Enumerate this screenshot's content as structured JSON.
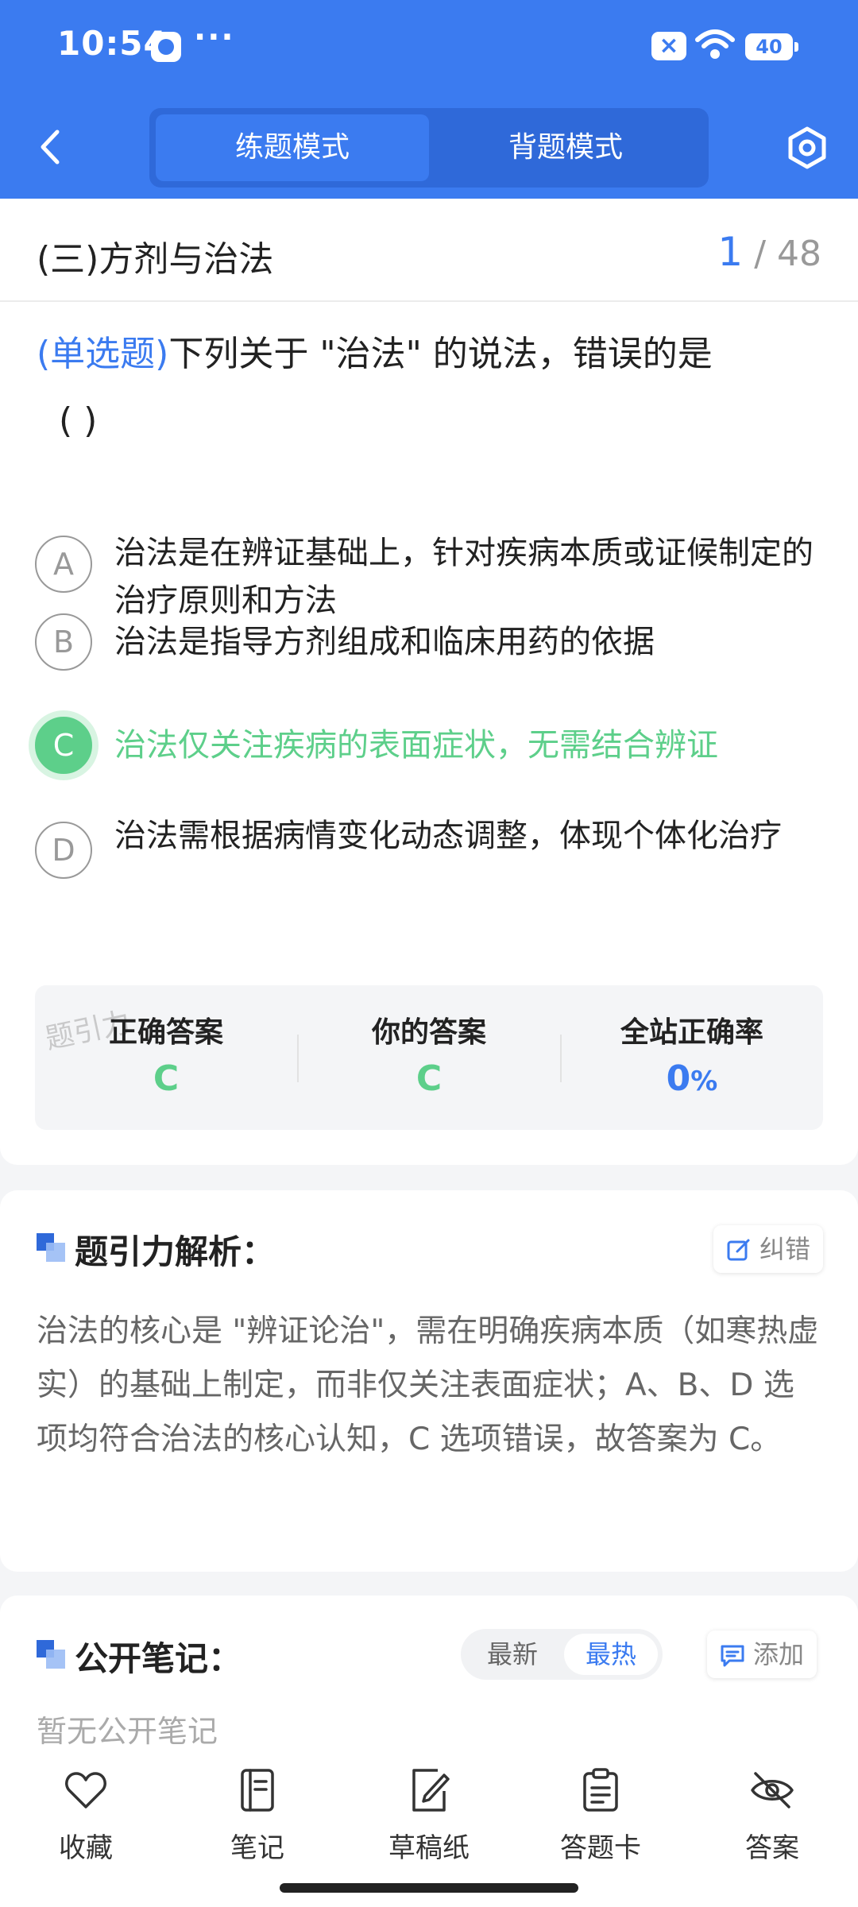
{
  "status_bar": {
    "time": "10:54",
    "dots": "···",
    "battery": "40"
  },
  "header": {
    "tabs": [
      {
        "label": "练题模式",
        "active": true
      },
      {
        "label": "背题模式",
        "active": false
      }
    ],
    "icons": [
      "back-icon",
      "settings-icon"
    ]
  },
  "question": {
    "section_title": "(三)方剂与治法",
    "current": "1",
    "total": "/ 48",
    "type": "(单选题)",
    "stem": "下列关于 \"治法\" 的说法，错误的是",
    "blank": "(        )",
    "options": [
      {
        "letter": "A",
        "text": "治法是在辨证基础上，针对疾病本质或证候制定的治疗原则和方法",
        "state": "normal"
      },
      {
        "letter": "B",
        "text": "治法是指导方剂组成和临床用药的依据",
        "state": "normal"
      },
      {
        "letter": "C",
        "text": "治法仅关注疾病的表面症状，无需结合辨证",
        "state": "correct"
      },
      {
        "letter": "D",
        "text": "治法需根据病情变化动态调整，体现个体化治疗",
        "state": "normal"
      }
    ]
  },
  "answers": {
    "watermark": "题引力",
    "correct_label": "正确答案",
    "correct_value": "C",
    "yours_label": "你的答案",
    "yours_value": "C",
    "rate_label": "全站正确率",
    "rate_value": "0",
    "rate_unit": "%"
  },
  "analysis": {
    "title": "题引力解析：",
    "correction_button": "纠错",
    "text": "治法的核心是 \"辨证论治\"，需在明确疾病本质（如寒热虚实）的基础上制定，而非仅关注表面症状；A、B、D 选项均符合治法的核心认知，C 选项错误，故答案为 C。"
  },
  "notes": {
    "title": "公开笔记：",
    "sort_latest": "最新",
    "sort_hot": "最热",
    "add_button": "添加",
    "empty_text": "暂无公开笔记"
  },
  "bottom_bar": {
    "items": [
      {
        "label": "收藏",
        "icon": "heart-icon"
      },
      {
        "label": "笔记",
        "icon": "notebook-icon"
      },
      {
        "label": "草稿纸",
        "icon": "draft-paper-icon"
      },
      {
        "label": "答题卡",
        "icon": "answer-card-icon"
      },
      {
        "label": "答案",
        "icon": "eye-off-icon"
      }
    ]
  },
  "colors": {
    "primary": "#3b7bf0",
    "correct": "#5dcf8a",
    "background": "#f4f5f7"
  }
}
